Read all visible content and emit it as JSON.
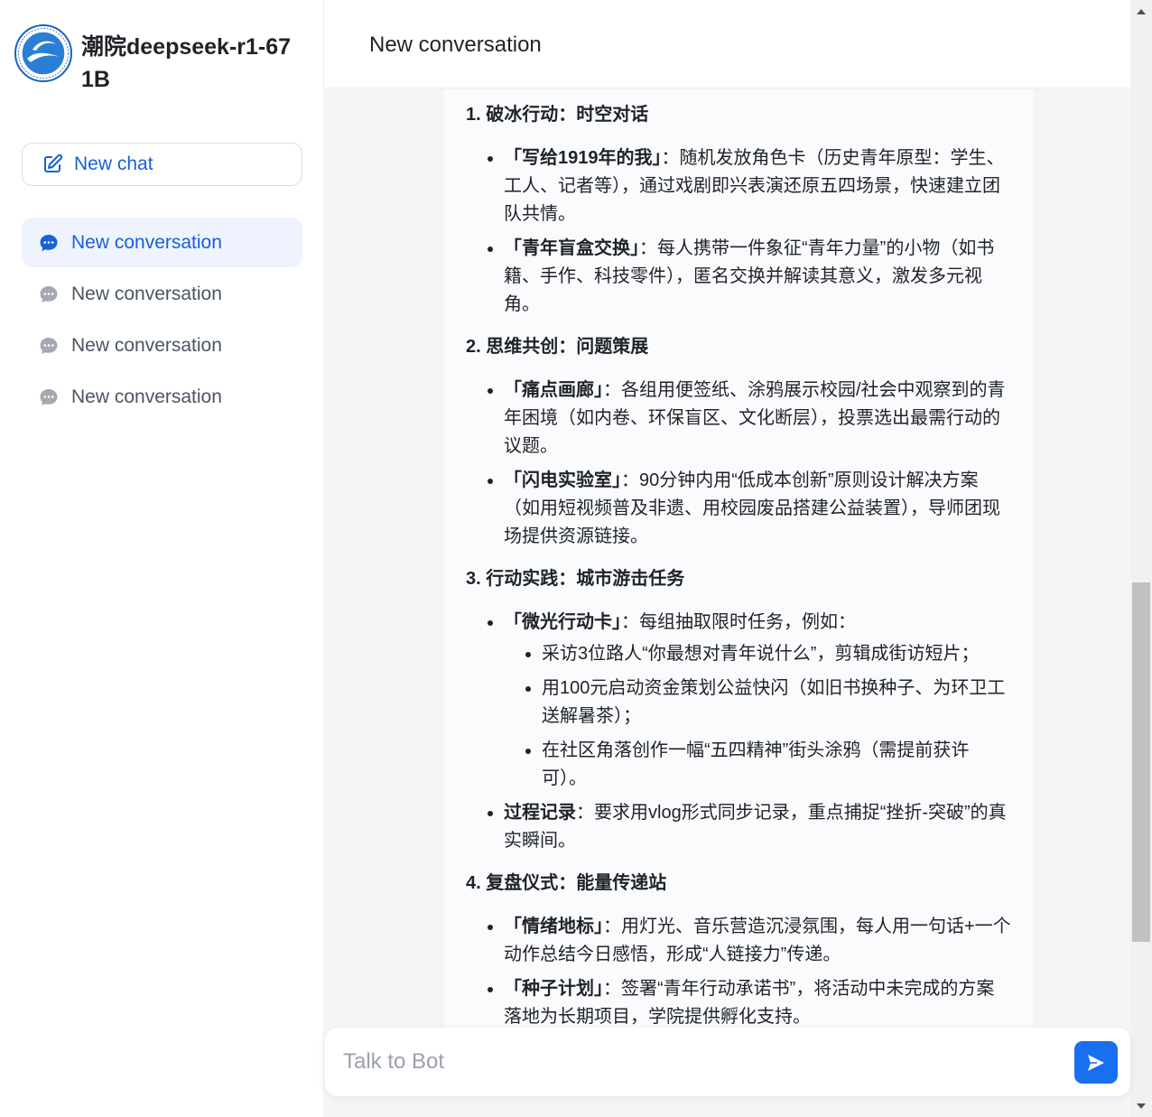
{
  "app": {
    "title": "潮院deepseek-r1-671B",
    "logo_icon": "college-logo-icon"
  },
  "sidebar": {
    "new_chat_label": "New chat",
    "conversations": [
      {
        "label": "New conversation",
        "active": true
      },
      {
        "label": "New conversation",
        "active": false
      },
      {
        "label": "New conversation",
        "active": false
      },
      {
        "label": "New conversation",
        "active": false
      }
    ]
  },
  "header": {
    "title": "New conversation"
  },
  "message": {
    "sections": [
      {
        "heading": "1. 破冰行动：时空对话",
        "items": [
          {
            "bold": "「写给1919年的我」",
            "text": "：随机发放角色卡（历史青年原型：学生、工人、记者等），通过戏剧即兴表演还原五四场景，快速建立团队共情。"
          },
          {
            "bold": "「青年盲盒交换」",
            "text": "：每人携带一件象征“青年力量”的小物（如书籍、手作、科技零件），匿名交换并解读其意义，激发多元视角。"
          }
        ]
      },
      {
        "heading": "2. 思维共创：问题策展",
        "items": [
          {
            "bold": "「痛点画廊」",
            "text": "：各组用便签纸、涂鸦展示校园/社会中观察到的青年困境（如内卷、环保盲区、文化断层），投票选出最需行动的议题。"
          },
          {
            "bold": "「闪电实验室」",
            "text": "：90分钟内用“低成本创新”原则设计解决方案（如用短视频普及非遗、用校园废品搭建公益装置），导师团现场提供资源链接。"
          }
        ]
      },
      {
        "heading": "3. 行动实践：城市游击任务",
        "items": [
          {
            "bold": "「微光行动卡」",
            "text": "：每组抽取限时任务，例如：",
            "sub": [
              "采访3位路人“你最想对青年说什么”，剪辑成街访短片；",
              "用100元启动资金策划公益快闪（如旧书换种子、为环卫工送解暑茶）；",
              "在社区角落创作一幅“五四精神”街头涂鸦（需提前获许可）。"
            ]
          },
          {
            "bold": "过程记录",
            "text": "：要求用vlog形式同步记录，重点捕捉“挫折-突破”的真实瞬间。"
          }
        ]
      },
      {
        "heading": "4. 复盘仪式：能量传递站",
        "items": [
          {
            "bold": "「情绪地标」",
            "text": "：用灯光、音乐营造沉浸氛围，每人用一句话+一个动作总结今日感悟，形成“人链接力”传递。"
          },
          {
            "bold": "「种子计划」",
            "text": "：签署“青年行动承诺书”，将活动中未完成的方案落地为长期项目，学院提供孵化支持。"
          }
        ]
      }
    ]
  },
  "input": {
    "placeholder": "Talk to Bot"
  },
  "colors": {
    "accent": "#1a6ff0",
    "active_bg": "#eef3fd"
  }
}
